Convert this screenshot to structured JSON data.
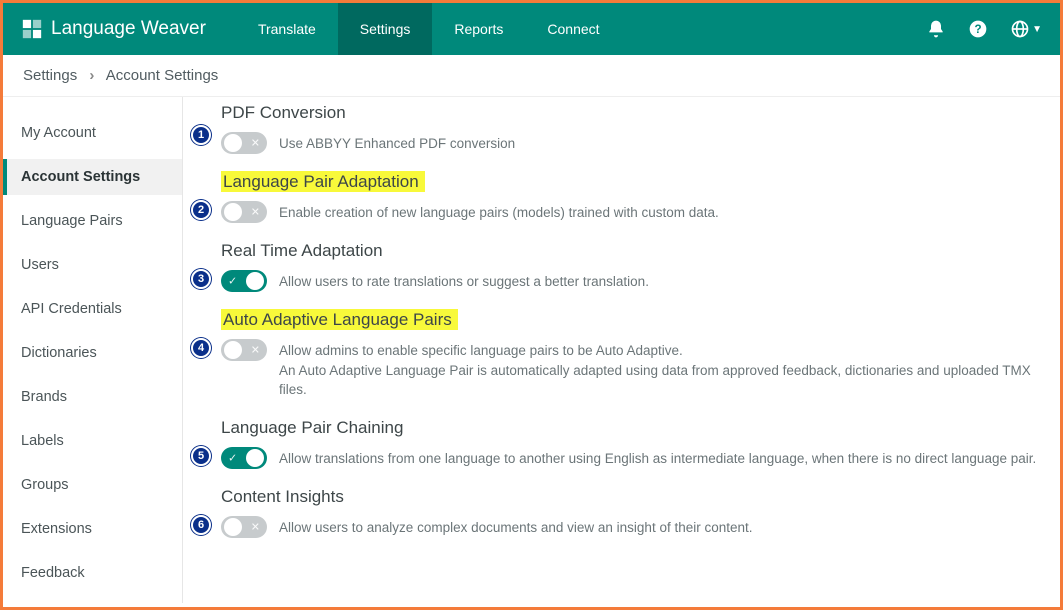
{
  "app": {
    "name": "Language Weaver"
  },
  "nav": {
    "translate": "Translate",
    "settings": "Settings",
    "reports": "Reports",
    "connect": "Connect"
  },
  "breadcrumb": {
    "root": "Settings",
    "current": "Account Settings"
  },
  "sidebar": {
    "items": [
      {
        "label": "My Account"
      },
      {
        "label": "Account Settings"
      },
      {
        "label": "Language Pairs"
      },
      {
        "label": "Users"
      },
      {
        "label": "API Credentials"
      },
      {
        "label": "Dictionaries"
      },
      {
        "label": "Brands"
      },
      {
        "label": "Labels"
      },
      {
        "label": "Groups"
      },
      {
        "label": "Extensions"
      },
      {
        "label": "Feedback"
      }
    ],
    "active_index": 1
  },
  "sections": [
    {
      "badge": "1",
      "title": "PDF Conversion",
      "highlight": false,
      "toggle_on": false,
      "desc": "Use ABBYY Enhanced PDF conversion"
    },
    {
      "badge": "2",
      "title": "Language Pair Adaptation",
      "highlight": true,
      "toggle_on": false,
      "desc": "Enable creation of new language pairs (models) trained with custom data."
    },
    {
      "badge": "3",
      "title": "Real Time Adaptation",
      "highlight": false,
      "toggle_on": true,
      "desc": "Allow users to rate translations or suggest a better translation."
    },
    {
      "badge": "4",
      "title": "Auto Adaptive Language Pairs",
      "highlight": true,
      "toggle_on": false,
      "desc": "Allow admins to enable specific language pairs to be Auto Adaptive.\nAn Auto Adaptive Language Pair is automatically adapted using data from approved feedback, dictionaries and uploaded TMX files."
    },
    {
      "badge": "5",
      "title": "Language Pair Chaining",
      "highlight": false,
      "toggle_on": true,
      "desc": "Allow translations from one language to another using English as intermediate language, when there is no direct language pair."
    },
    {
      "badge": "6",
      "title": "Content Insights",
      "highlight": false,
      "toggle_on": false,
      "desc": "Allow users to analyze complex documents and view an insight of their content."
    }
  ]
}
